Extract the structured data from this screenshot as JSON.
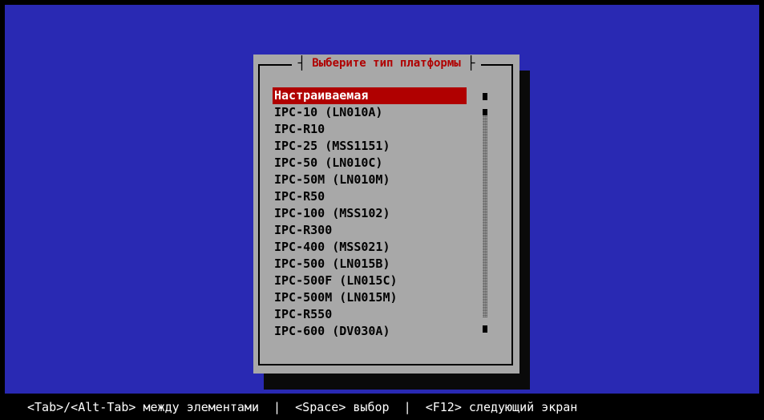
{
  "dialog": {
    "title": "Выберите тип платформы"
  },
  "platform_list": {
    "items": [
      "Настраиваемая",
      "IPC-10 (LN010A)",
      "IPC-R10",
      "IPC-25 (MSS1151)",
      "IPC-50 (LN010C)",
      "IPC-50M (LN010M)",
      "IPC-R50",
      "IPC-100 (MSS102)",
      "IPC-R300",
      "IPC-400 (MSS021)",
      "IPC-500 (LN015B)",
      "IPC-500F (LN015C)",
      "IPC-500M (LN015M)",
      "IPC-R550",
      "IPC-600 (DV030A)"
    ],
    "selected_index": 0
  },
  "status_bar": {
    "text": "<Tab>/<Alt-Tab> между элементами  |  <Space> выбор  |  <F12> следующий экран"
  },
  "colors": {
    "desktop": "#2929b3",
    "dialog": "#a8a8a8",
    "title": "#b00000",
    "selection": "#b00000"
  }
}
